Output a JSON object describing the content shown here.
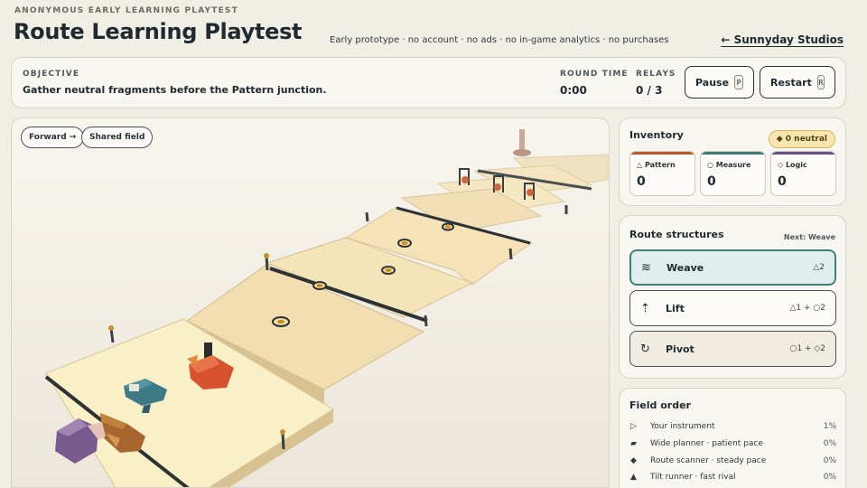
{
  "header": {
    "eyebrow": "ANONYMOUS EARLY LEARNING PLAYTEST",
    "title": "Route Learning Playtest",
    "tagline": "Early prototype · no account · no ads · no in-game analytics · no purchases",
    "studio_link": "← Sunnyday Studios"
  },
  "objective": {
    "label": "OBJECTIVE",
    "text": "Gather neutral fragments before the Pattern junction."
  },
  "stats": {
    "round_time_label": "ROUND TIME",
    "round_time": "0:00",
    "relays_label": "RELAYS",
    "relays": "0 / 3"
  },
  "controls": {
    "pause_label": "Pause",
    "pause_key": "P",
    "restart_label": "Restart",
    "restart_key": "R"
  },
  "field": {
    "chip_forward": "Forward →",
    "chip_shared": "Shared field"
  },
  "inventory": {
    "title": "Inventory",
    "neutral_badge": "◆ 0 neutral",
    "items": [
      {
        "label": "△ Pattern",
        "count": "0",
        "color": "#c0552f"
      },
      {
        "label": "○ Measure",
        "count": "0",
        "color": "#3c7a78"
      },
      {
        "label": "◇ Logic",
        "count": "0",
        "color": "#6a4e8a"
      }
    ]
  },
  "route_structures": {
    "title": "Route structures",
    "next": "Next: Weave",
    "items": [
      {
        "icon": "≋",
        "label": "Weave",
        "cost": "△2"
      },
      {
        "icon": "⇡",
        "label": "Lift",
        "cost": "△1 + ○2"
      },
      {
        "icon": "↻",
        "label": "Pivot",
        "cost": "○1 + ◇2"
      }
    ]
  },
  "field_order": {
    "title": "Field order",
    "rows": [
      {
        "symbol": "▷",
        "label": "Your instrument",
        "pct": "1%"
      },
      {
        "symbol": "▰",
        "label": "Wide planner · patient pace",
        "pct": "0%"
      },
      {
        "symbol": "◆",
        "label": "Route scanner · steady pace",
        "pct": "0%"
      },
      {
        "symbol": "▲",
        "label": "Tilt runner · fast rival",
        "pct": "0%"
      }
    ]
  },
  "colors": {
    "background": "#f1eee6",
    "accent_teal": "#3f7f7a",
    "pattern_orange": "#c0552f",
    "logic_purple": "#6a4e8a",
    "badge_gold": "#f7e6b0"
  }
}
